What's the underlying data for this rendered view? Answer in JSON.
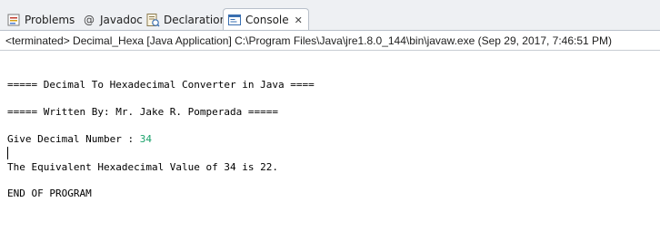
{
  "tabs": [
    {
      "label": "Problems",
      "icon": "problems-icon"
    },
    {
      "label": "Javadoc",
      "icon": "javadoc-at-icon",
      "glyph": "@"
    },
    {
      "label": "Declaration",
      "icon": "declaration-icon"
    },
    {
      "label": "Console",
      "icon": "console-icon",
      "active": true,
      "close": "✕"
    }
  ],
  "status": "<terminated> Decimal_Hexa [Java Application] C:\\Program Files\\Java\\jre1.8.0_144\\bin\\javaw.exe (Sep 29, 2017, 7:46:51 PM)",
  "console": {
    "line1": "===== Decimal To Hexadecimal Converter in Java ====",
    "line2": "===== Written By: Mr. Jake R. Pomperada =====",
    "prompt": "Give Decimal Number : ",
    "input": "34",
    "result": "The Equivalent Hexadecimal Value of 34 is 22.",
    "end": "END OF PROGRAM"
  },
  "colors": {
    "user_input": "#1aa26b",
    "tab_border": "#b8c0ca"
  }
}
